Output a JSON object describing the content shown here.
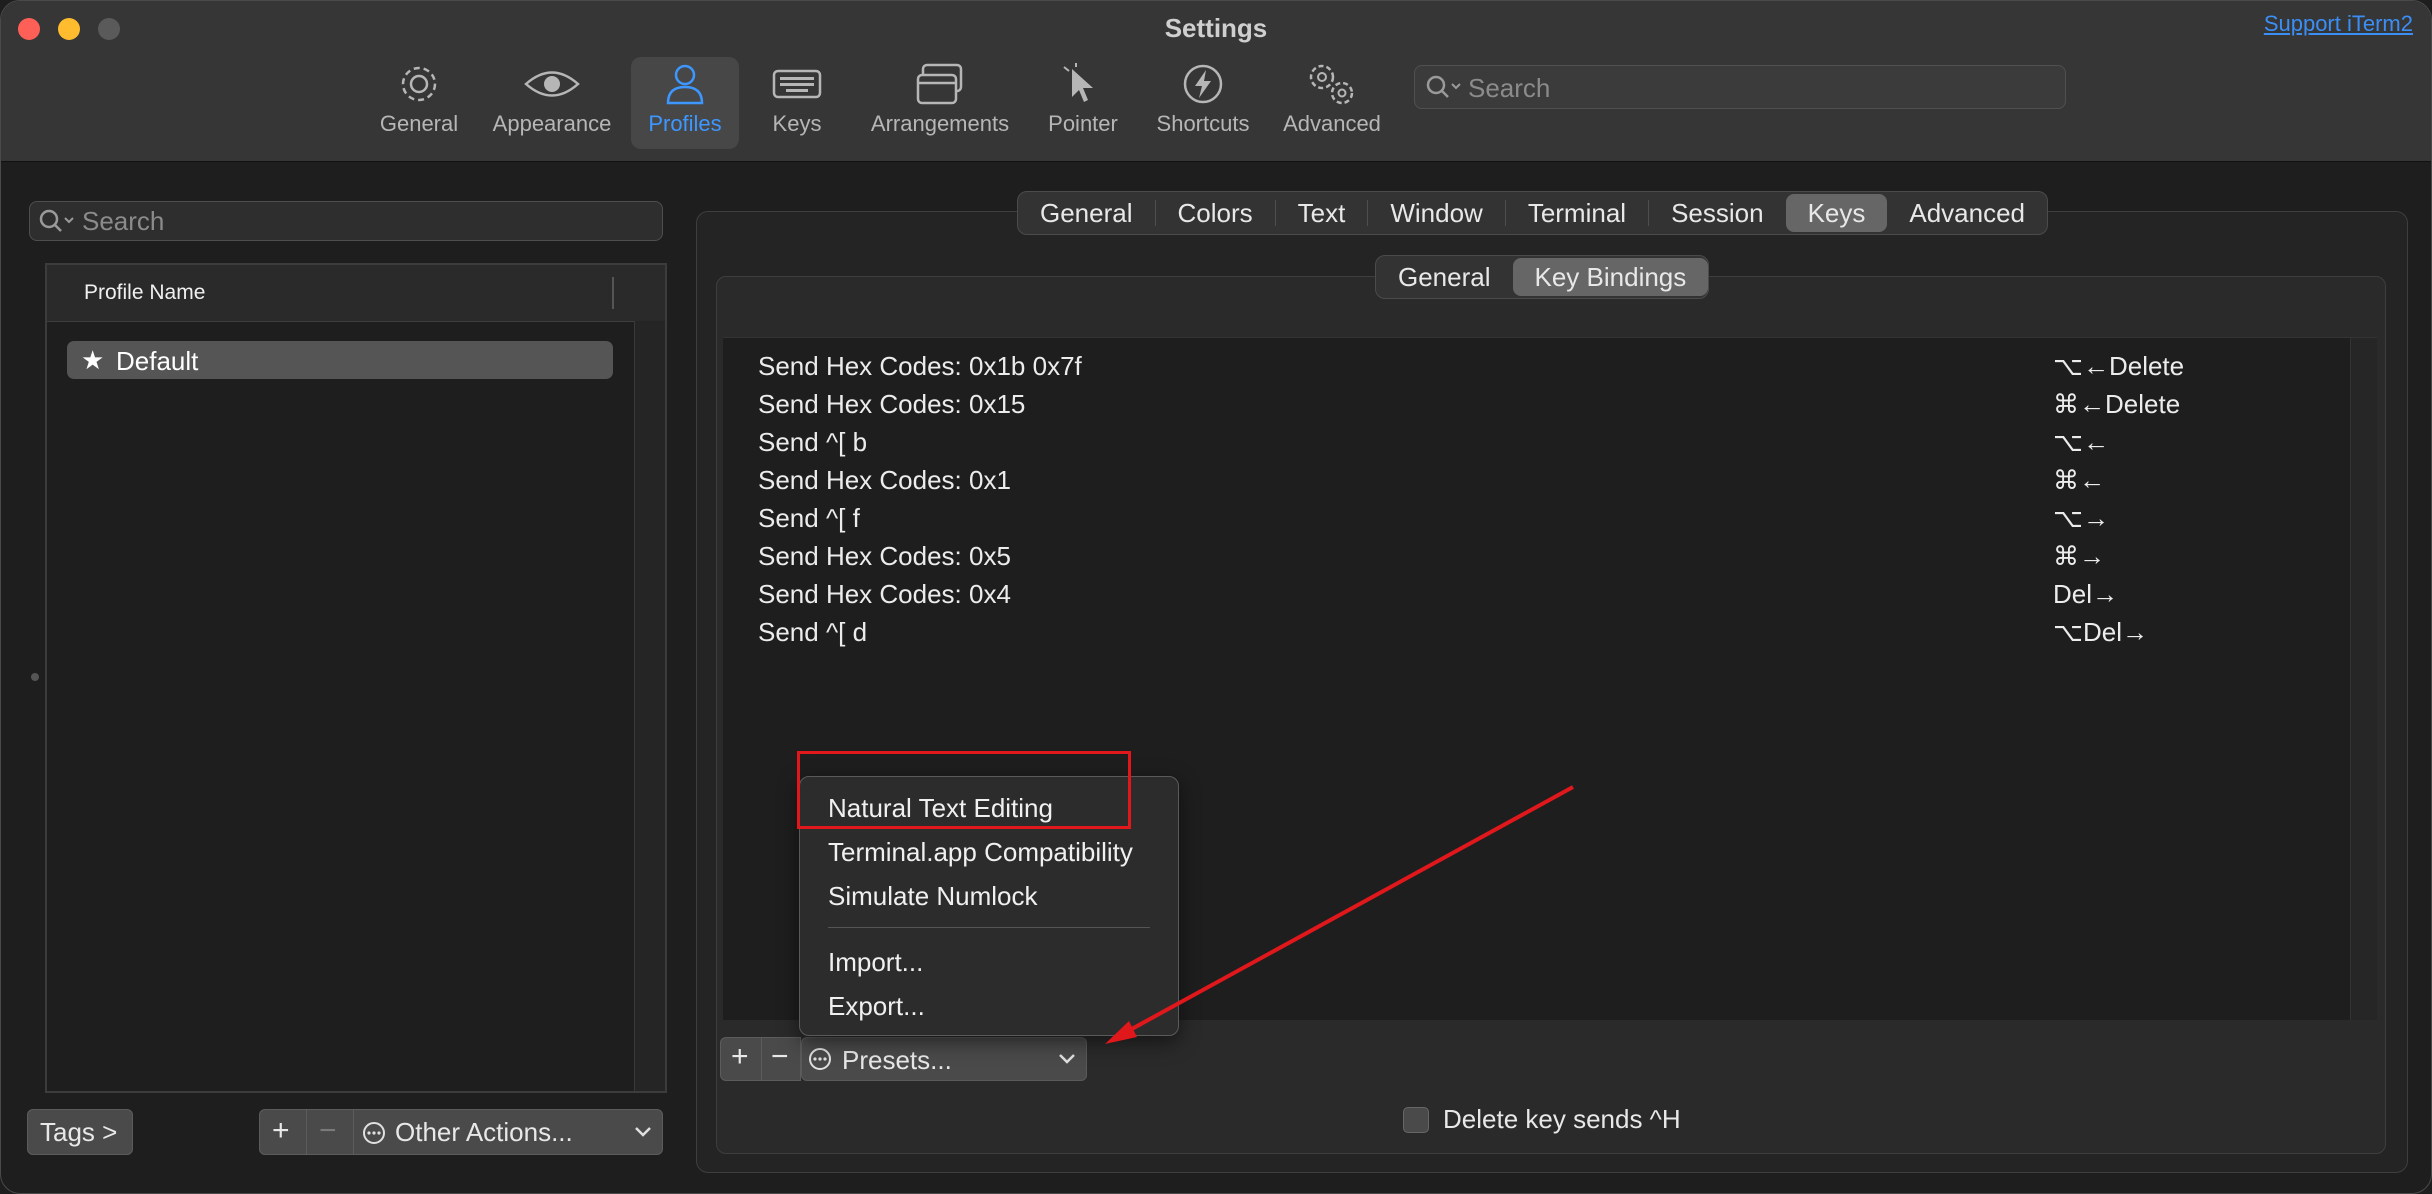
{
  "window": {
    "title": "Settings",
    "support_link": "Support iTerm2"
  },
  "toolbar": {
    "items": [
      {
        "label": "General",
        "icon": "gear-icon"
      },
      {
        "label": "Appearance",
        "icon": "eye-icon"
      },
      {
        "label": "Profiles",
        "icon": "person-icon",
        "active": true
      },
      {
        "label": "Keys",
        "icon": "keyboard-icon"
      },
      {
        "label": "Arrangements",
        "icon": "windows-icon"
      },
      {
        "label": "Pointer",
        "icon": "pointer-icon"
      },
      {
        "label": "Shortcuts",
        "icon": "bolt-icon"
      },
      {
        "label": "Advanced",
        "icon": "gears-icon"
      }
    ],
    "search_placeholder": "Search"
  },
  "sidebar": {
    "search_placeholder": "Search",
    "column_header": "Profile Name",
    "profiles": [
      {
        "name": "Default",
        "starred": true
      }
    ],
    "tags_button": "Tags >",
    "add_symbol": "+",
    "remove_symbol": "−",
    "other_actions": "Other Actions..."
  },
  "profile_tabs": {
    "items": [
      "General",
      "Colors",
      "Text",
      "Window",
      "Terminal",
      "Session",
      "Keys",
      "Advanced"
    ],
    "active": "Keys"
  },
  "keys_subtabs": {
    "items": [
      "General",
      "Key Bindings"
    ],
    "active": "Key Bindings"
  },
  "key_bindings": [
    {
      "action": "Send Hex Codes: 0x1b 0x7f",
      "key": "⌥←Delete"
    },
    {
      "action": "Send Hex Codes: 0x15",
      "key": "⌘←Delete"
    },
    {
      "action": "Send ^[ b",
      "key": "⌥←"
    },
    {
      "action": "Send Hex Codes: 0x1",
      "key": "⌘←"
    },
    {
      "action": "Send ^[ f",
      "key": "⌥→"
    },
    {
      "action": "Send Hex Codes: 0x5",
      "key": "⌘→"
    },
    {
      "action": "Send Hex Codes: 0x4",
      "key": "Del→"
    },
    {
      "action": "Send ^[ d",
      "key": "⌥Del→"
    }
  ],
  "table_controls": {
    "add_symbol": "+",
    "remove_symbol": "−",
    "presets_label": "Presets..."
  },
  "presets_menu": {
    "items": [
      "Natural Text Editing",
      "Terminal.app Compatibility",
      "Simulate Numlock"
    ],
    "file_items": [
      "Import...",
      "Export..."
    ]
  },
  "delete_key_option": {
    "label": "Delete key sends ^H",
    "checked": false
  },
  "colors": {
    "accent": "#3d97ff",
    "annotation": "#e0171b"
  }
}
